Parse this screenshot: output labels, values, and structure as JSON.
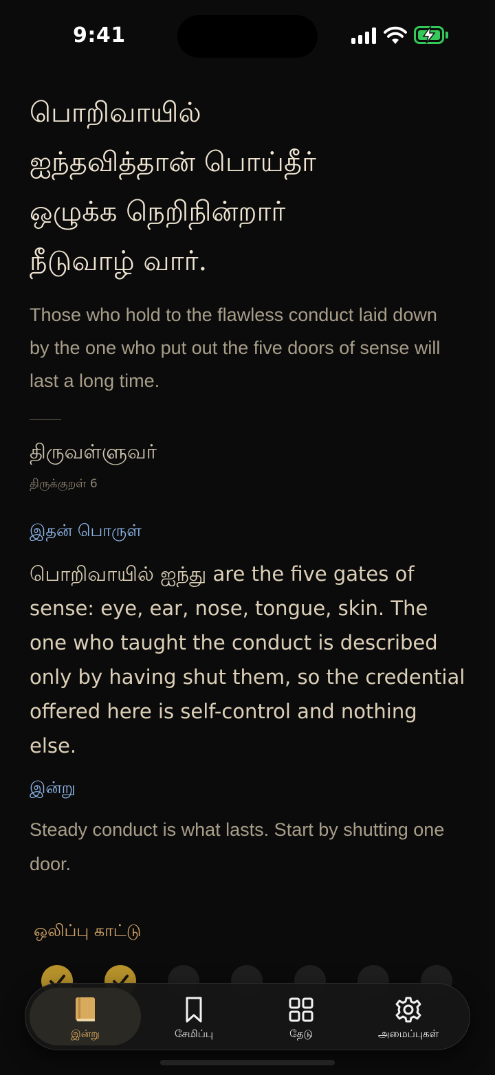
{
  "status_bar": {
    "time": "9:41"
  },
  "verse": {
    "lines": [
      "பொறிவாயில்",
      "ஐந்தவித்தான் பொய்தீர்",
      "ஒழுக்க நெறிநின்றார்",
      "நீடுவாழ் வார்."
    ]
  },
  "translation": "Those who hold to the flawless conduct laid down by the one who put out the five doors of sense will last a long time.",
  "author": "திருவள்ளுவர்",
  "kural_number": "திருக்குறள் 6",
  "meaning": {
    "label": "இதன் பொருள்",
    "text": "பொறிவாயில் ஐந்து are the five gates of sense: eye, ear, nose, tongue, skin. The one who taught the conduct is described only by having shut them, so the credential offered here is self-control and nothing else."
  },
  "today": {
    "label": "இன்று",
    "text": "Steady conduct is what lasts. Start by shutting one door."
  },
  "streak": {
    "label": "ஒலிப்பு காட்டு",
    "days_done": [
      true,
      true,
      false,
      false,
      false,
      false,
      false
    ]
  },
  "tabbar": {
    "tabs": [
      {
        "label": "இன்று",
        "icon": "book-icon",
        "active": true
      },
      {
        "label": "சேமிப்பு",
        "icon": "bookmark-icon",
        "active": false
      },
      {
        "label": "தேடு",
        "icon": "grid-icon",
        "active": false
      },
      {
        "label": "அமைப்புகள்",
        "icon": "gear-icon",
        "active": false
      }
    ]
  },
  "colors": {
    "background": "#0b0b0b",
    "accent_gold": "#d8aa5e",
    "label_blue": "#8fb6ea",
    "battery_green": "#34c759"
  }
}
